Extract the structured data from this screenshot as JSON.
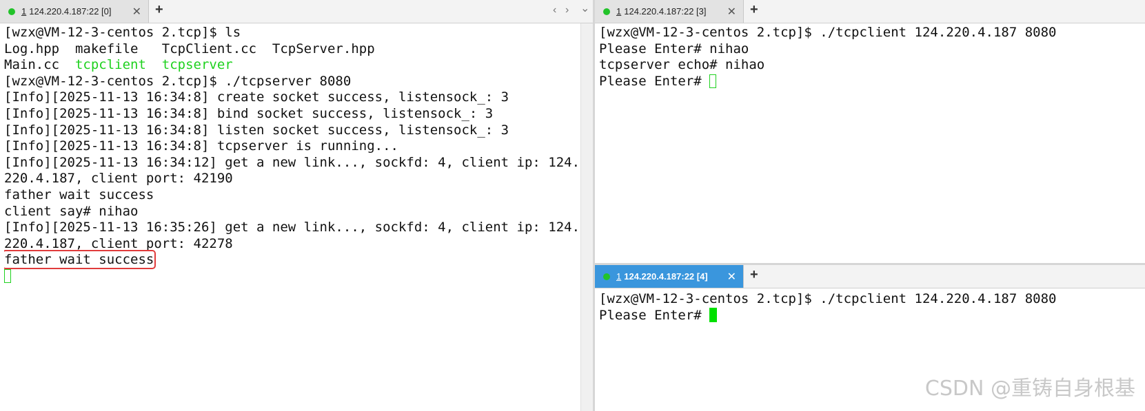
{
  "left_pane": {
    "tab": {
      "num": "1",
      "title": "124.220.4.187:22 [0]"
    },
    "lines": [
      [
        {
          "t": "[wzx@VM-12-3-centos 2.tcp]$ ls"
        }
      ],
      [
        {
          "t": "Log.hpp  makefile   TcpClient.cc  TcpServer.hpp"
        }
      ],
      [
        {
          "t": "Main.cc  "
        },
        {
          "t": "tcpclient",
          "c": "green"
        },
        {
          "t": "  "
        },
        {
          "t": "tcpserver",
          "c": "green"
        }
      ],
      [
        {
          "t": "[wzx@VM-12-3-centos 2.tcp]$ ./tcpserver 8080"
        }
      ],
      [
        {
          "t": "[Info][2025-11-13 16:34:8] create socket success, listensock_: 3"
        }
      ],
      [
        {
          "t": "[Info][2025-11-13 16:34:8] bind socket success, listensock_: 3"
        }
      ],
      [
        {
          "t": "[Info][2025-11-13 16:34:8] listen socket success, listensock_: 3"
        }
      ],
      [
        {
          "t": "[Info][2025-11-13 16:34:8] tcpserver is running..."
        }
      ],
      [
        {
          "t": "[Info][2025-11-13 16:34:12] get a new link..., sockfd: 4, client ip: 124."
        }
      ],
      [
        {
          "t": "220.4.187, client port: 42190"
        }
      ],
      [
        {
          "t": "father wait success"
        }
      ],
      [
        {
          "t": "client say# nihao"
        }
      ],
      [
        {
          "t": "[Info][2025-11-13 16:35:26] get a new link..., sockfd: 4, client ip: 124."
        }
      ],
      [
        {
          "t": "220.4.187, client port: 42278"
        }
      ],
      [
        {
          "t": "father wait success",
          "c": "highlight"
        }
      ],
      [
        {
          "cursor": "outline"
        }
      ]
    ]
  },
  "top_right_pane": {
    "tab": {
      "num": "1",
      "title": "124.220.4.187:22 [3]"
    },
    "lines": [
      [
        {
          "t": "[wzx@VM-12-3-centos 2.tcp]$ ./tcpclient 124.220.4.187 8080"
        }
      ],
      [
        {
          "t": "Please Enter# nihao"
        }
      ],
      [
        {
          "t": "tcpserver echo# nihao"
        }
      ],
      [
        {
          "t": "Please Enter# "
        },
        {
          "cursor": "outline"
        }
      ]
    ]
  },
  "bottom_right_pane": {
    "tab": {
      "num": "1",
      "title": "124.220.4.187:22 [4]"
    },
    "lines": [
      [
        {
          "t": "[wzx@VM-12-3-centos 2.tcp]$ ./tcpclient 124.220.4.187 8080"
        }
      ],
      [
        {
          "t": "Please Enter# "
        },
        {
          "cursor": "solid"
        }
      ]
    ]
  },
  "tab_controls": {
    "close": "✕",
    "add": "+",
    "prev": "‹",
    "next": "›",
    "menu": "⌄"
  },
  "colors": {
    "status_dot": "#22c32a",
    "active_tab": "#3a96dd",
    "executable": "#1ed11e",
    "highlight": "#e03b3b"
  },
  "watermark": "CSDN @重铸自身根基"
}
